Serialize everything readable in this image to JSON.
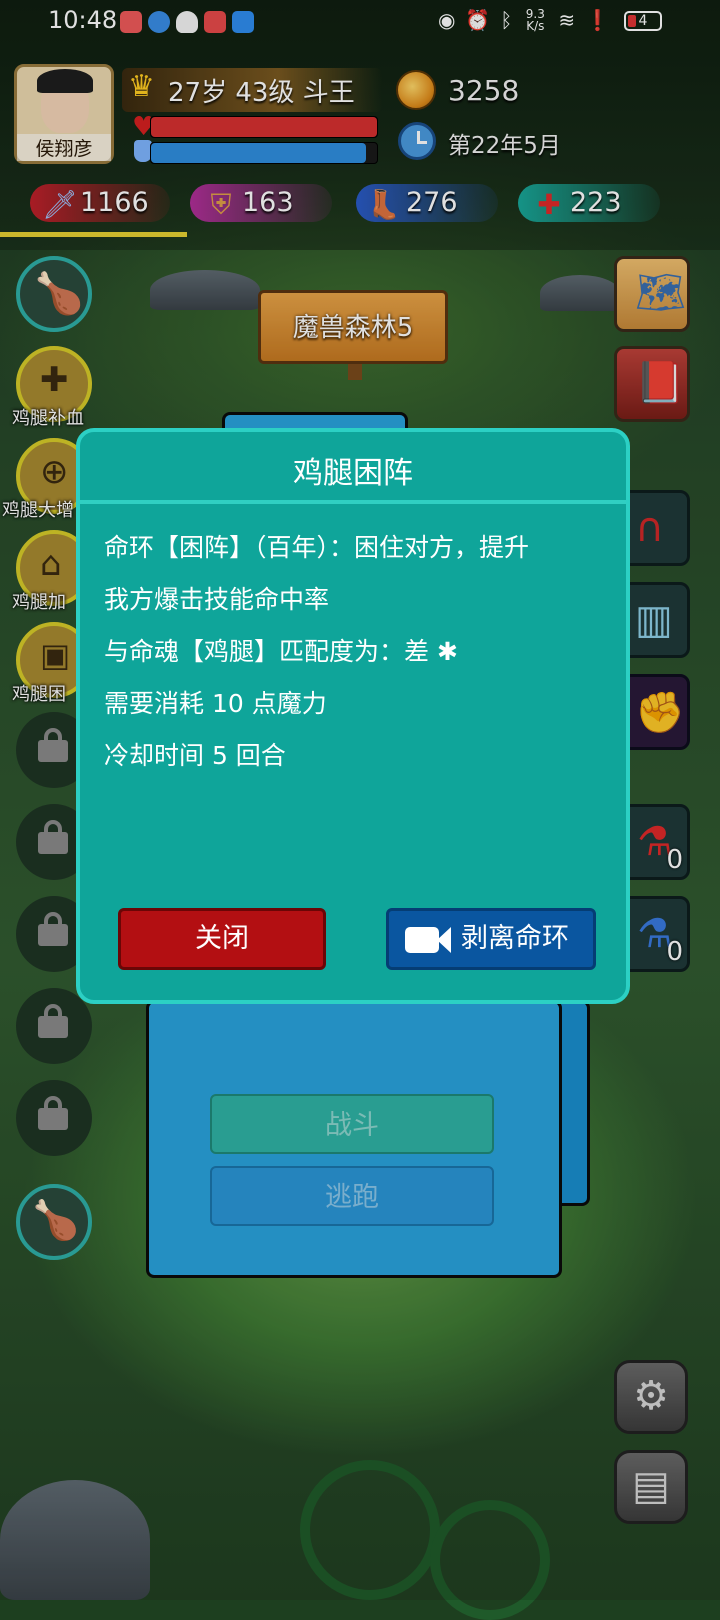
{
  "status_bar": {
    "time": "10:48",
    "net_speed": "9.3 K/s",
    "battery": "4"
  },
  "player": {
    "name": "侯翔彦",
    "level": "27岁 43级 斗王",
    "coins": "3258",
    "date": "第22年5月",
    "hp_fraction": 1.0,
    "mp_fraction": 0.95
  },
  "stats": {
    "attack": "1166",
    "defense": "163",
    "speed": "276",
    "health": "223"
  },
  "xp_fraction": 0.26,
  "location": "魔兽森林5",
  "skills": [
    {
      "label": "鸡腿补血"
    },
    {
      "label": "鸡腿大增"
    },
    {
      "label": "鸡腿加"
    },
    {
      "label": "鸡腿困"
    }
  ],
  "potions": {
    "red_count": "0",
    "blue_count": "0"
  },
  "battle": {
    "fight_label": "战斗",
    "flee_label": "逃跑"
  },
  "modal": {
    "title": "鸡腿困阵",
    "lines": [
      "命环【困阵】（百年）：困住对方，提升",
      "我方爆击技能命中率",
      "与命魂【鸡腿】匹配度为：差 ✱",
      "需要消耗 10 点魔力",
      "冷却时间 5 回合"
    ],
    "close_label": "关闭",
    "strip_label": "剥离命环"
  },
  "colors": {
    "modal_bg": "#0fa59a",
    "close_btn": "#b30f12",
    "strip_btn": "#0a56a0",
    "hp": "#d63030",
    "mp": "#2f8fe0"
  }
}
